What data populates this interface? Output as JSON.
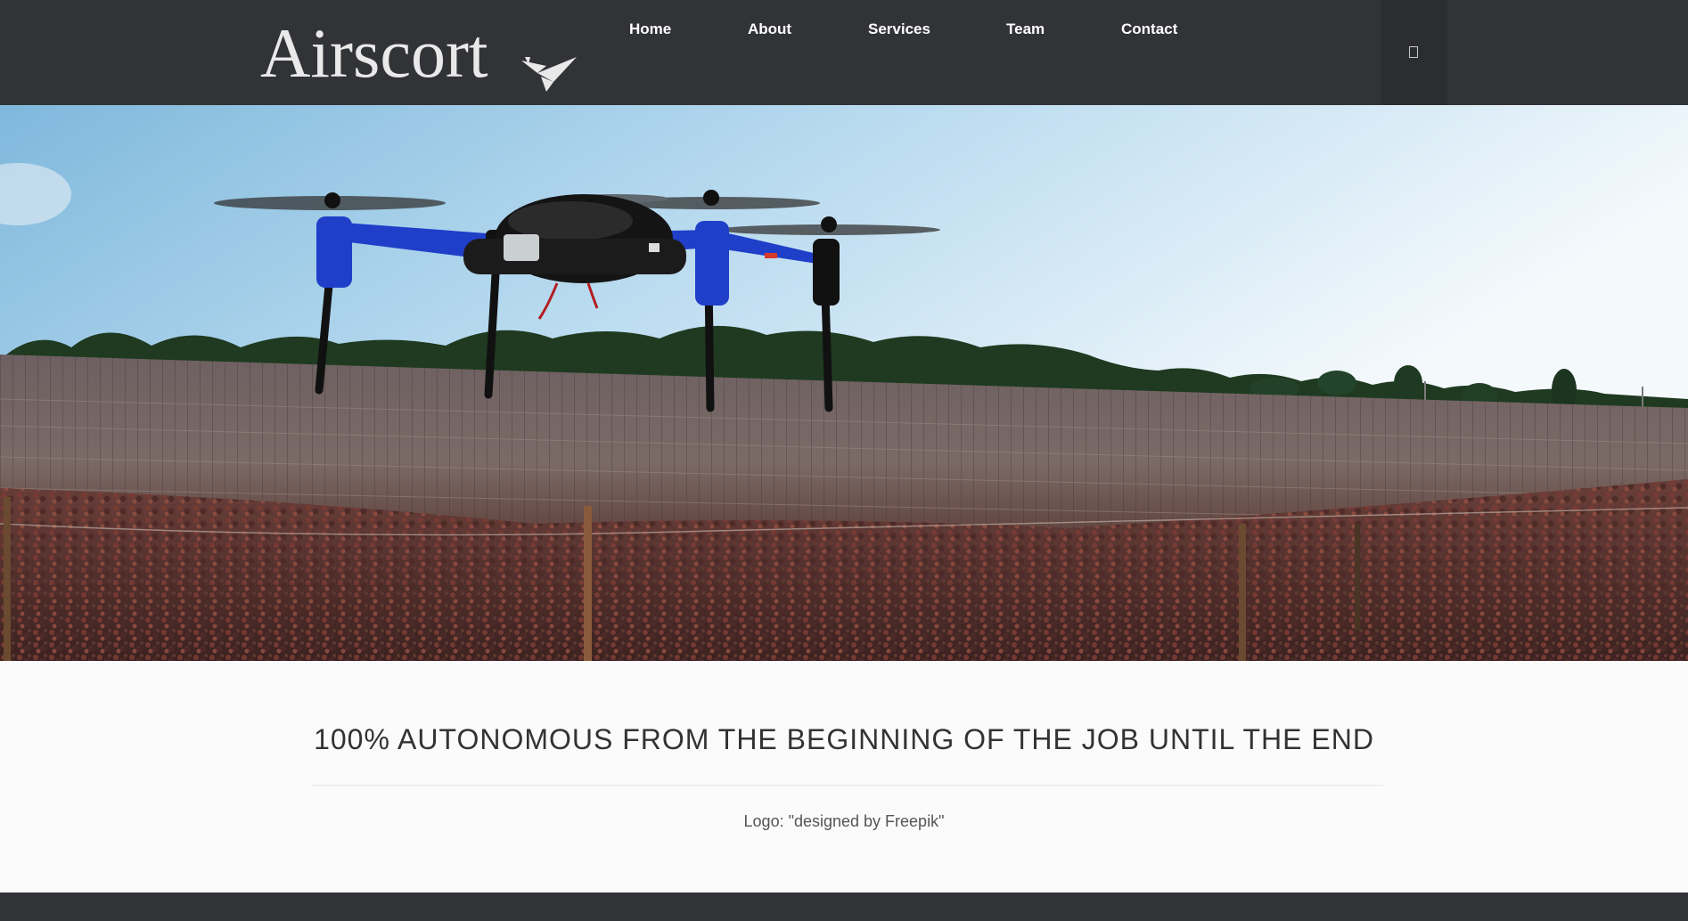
{
  "brand": {
    "name": "Airscort",
    "logo_icon": "paper-plane-bird-icon",
    "logo_color": "#e9e9e9"
  },
  "nav": {
    "items": [
      {
        "label": "Home"
      },
      {
        "label": "About"
      },
      {
        "label": "Services"
      },
      {
        "label": "Team"
      },
      {
        "label": "Contact"
      }
    ]
  },
  "header_tool": {
    "icon": "page-icon"
  },
  "hero": {
    "image_alt": "hero-photo-drone-vineyard"
  },
  "main": {
    "headline": "100% AUTONOMOUS FROM THE BEGINNING OF THE JOB UNTIL THE END",
    "credit": "Logo: \"designed by Freepik\""
  },
  "colors": {
    "header_bg": "#323336",
    "page_bg": "#fbfbfb",
    "text_dark": "#333333",
    "text_muted": "#555555",
    "drone_accent": "#1f3fc9"
  }
}
